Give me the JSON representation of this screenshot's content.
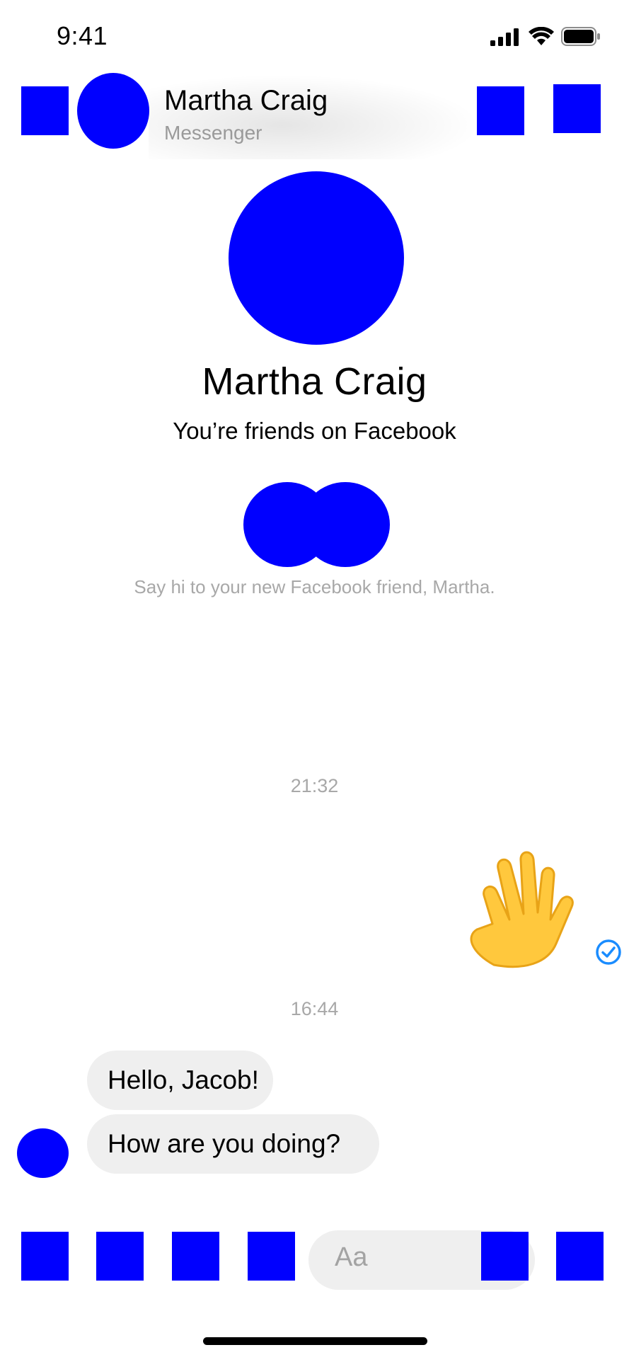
{
  "status_bar": {
    "time": "9:41",
    "icons": [
      "signal-icon",
      "wifi-icon",
      "battery-icon"
    ]
  },
  "header": {
    "name": "Martha Craig",
    "subtitle": "Messenger",
    "icons": [
      "back-icon",
      "call-icon",
      "video-call-icon"
    ]
  },
  "profile": {
    "name": "Martha Craig",
    "relationship": "You’re friends on Facebook",
    "prompt": "Say hi to your new Facebook friend, Martha."
  },
  "conversation": {
    "timestamp_1": "21:32",
    "sent_emoji": "👋",
    "timestamp_2": "16:44",
    "messages": [
      {
        "text": "Hello, Jacob!"
      },
      {
        "text": "How are you doing?"
      }
    ]
  },
  "composer": {
    "placeholder": "Aa",
    "icons": [
      "more-icon",
      "camera-icon",
      "gallery-icon",
      "mic-icon",
      "emoji-icon",
      "like-icon"
    ]
  },
  "colors": {
    "placeholder_block": "#0000ff",
    "bubble": "#efefef",
    "muted_text": "#a8a8a8",
    "seen_check": "#1a8cff"
  }
}
